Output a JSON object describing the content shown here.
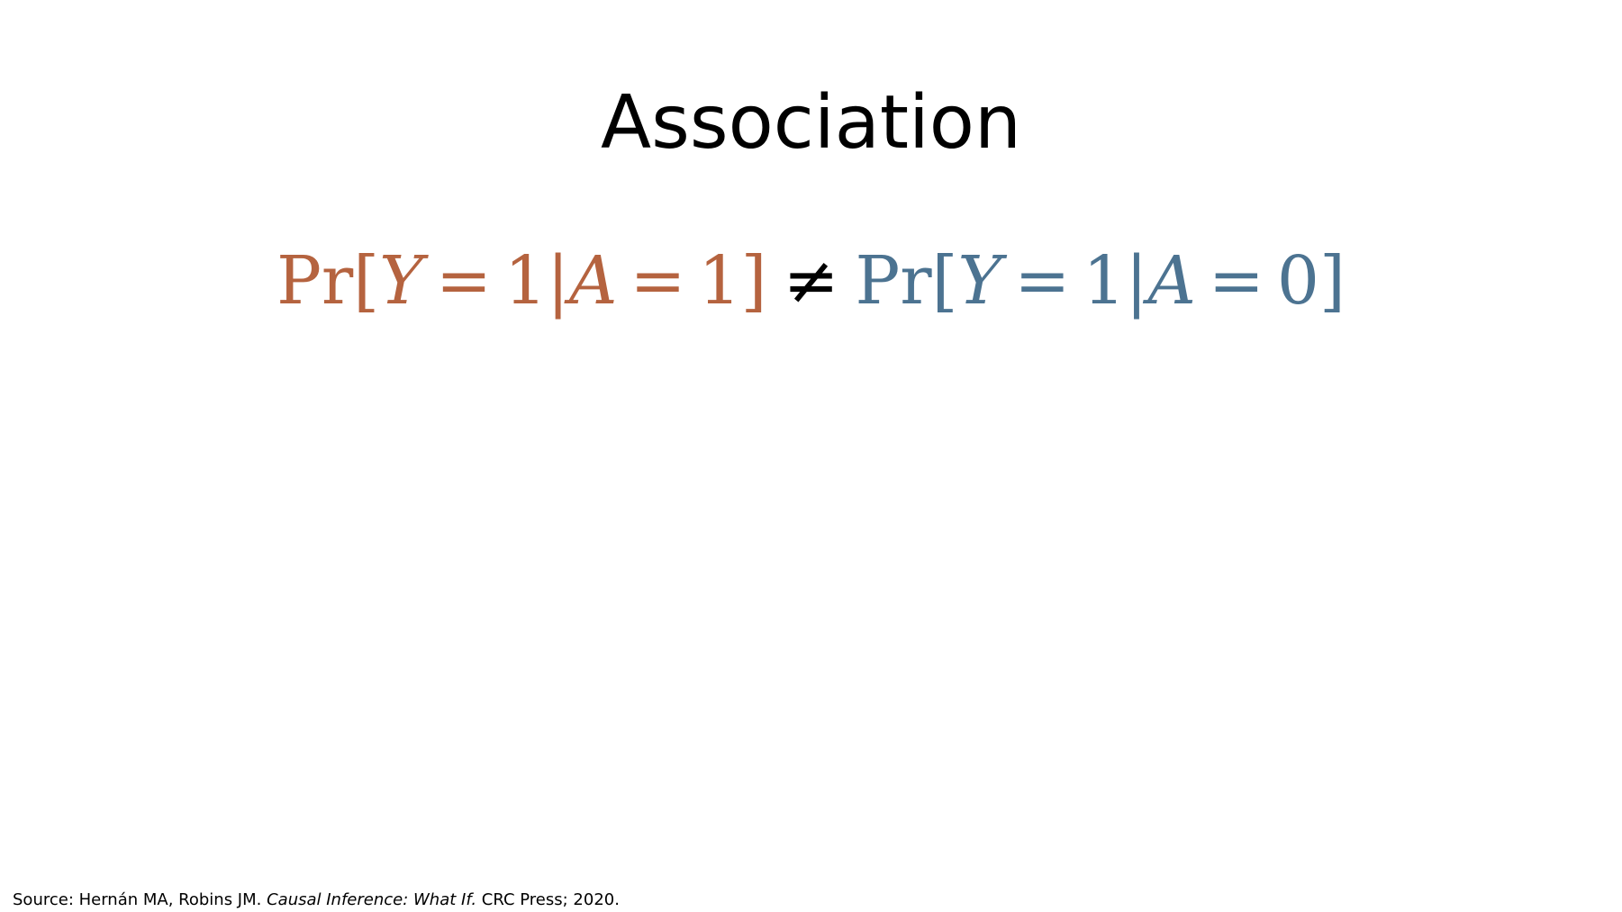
{
  "slide": {
    "title": "Association",
    "formula": {
      "lhs": {
        "fn": "Pr",
        "open": "[",
        "var1": "Y",
        "eq1": "=",
        "val1": "1",
        "bar": "|",
        "var2": "A",
        "eq2": "=",
        "val2": "1",
        "close": "]"
      },
      "relation": "≠",
      "rhs": {
        "fn": "Pr",
        "open": "[",
        "var1": "Y",
        "eq1": "=",
        "val1": "1",
        "bar": "|",
        "var2": "A",
        "eq2": "=",
        "val2": "0",
        "close": "]"
      }
    },
    "source": {
      "prefix": "Source: Hernán MA, Robins JM. ",
      "book_title": "Causal Inference: What If.",
      "suffix": " CRC Press; 2020."
    },
    "colors": {
      "lhs": "#b5633f",
      "rhs": "#4c7391",
      "text": "#000000",
      "background": "#ffffff"
    }
  }
}
